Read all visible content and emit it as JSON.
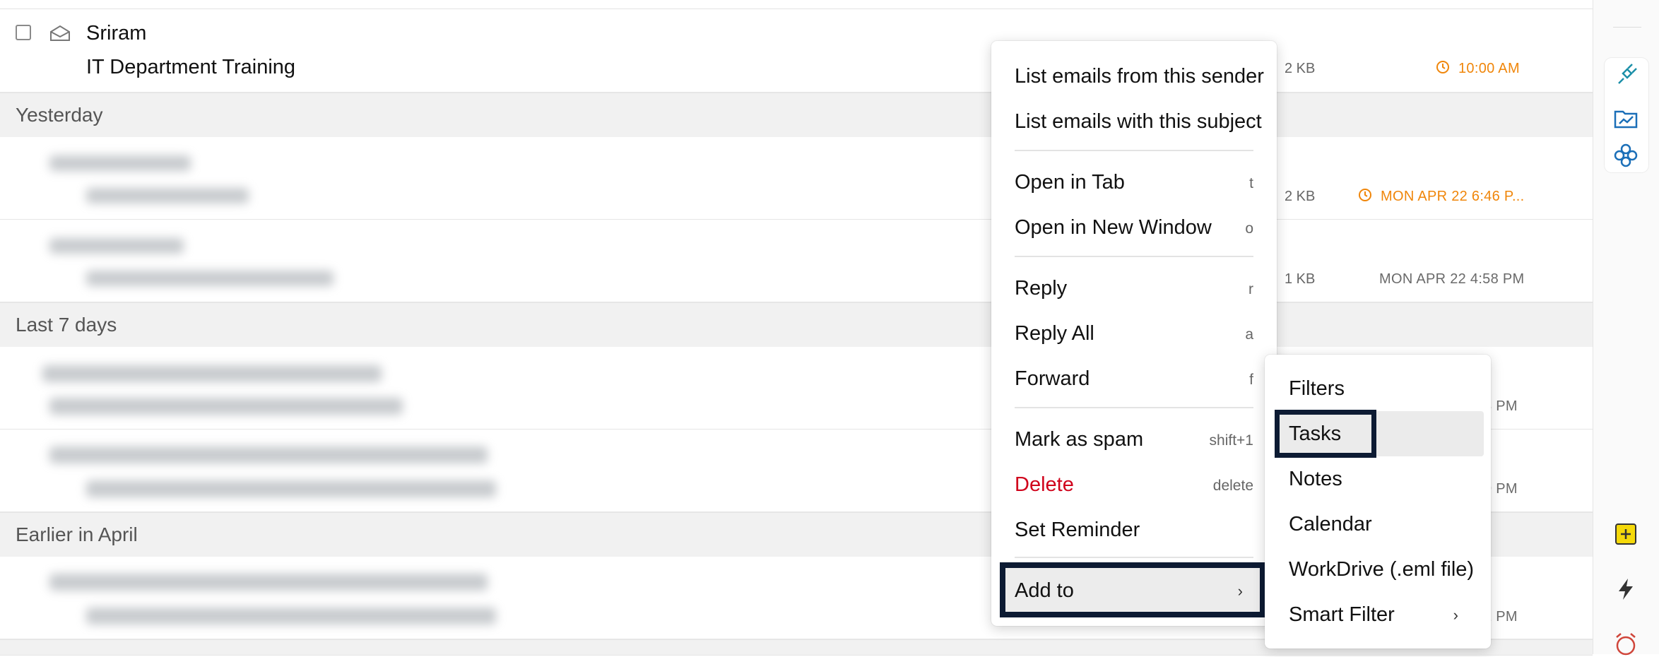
{
  "email_list": {
    "top_row": {
      "sender": "Sriram",
      "subject": "IT Department Training",
      "size": "2 KB",
      "time": "10:00 AM"
    },
    "groups": [
      {
        "label": "Yesterday",
        "rows": [
          {
            "size": "2 KB",
            "time": "MON APR 22 6:46 P..."
          },
          {
            "size": "1 KB",
            "time": "MON APR 22 4:58 PM"
          }
        ]
      },
      {
        "label": "Last 7 days",
        "rows": [
          {
            "time": "3 PM"
          },
          {
            "time": "9 PM"
          }
        ]
      },
      {
        "label": "Earlier in April",
        "rows": [
          {
            "time": "2 PM"
          }
        ]
      }
    ]
  },
  "context_menu": {
    "items": [
      {
        "label": "List emails from this sender",
        "key": ""
      },
      {
        "label": "List emails with this subject",
        "key": ""
      },
      {
        "label": "Open in Tab",
        "key": "t"
      },
      {
        "label": "Open in New Window",
        "key": "o"
      },
      {
        "label": "Reply",
        "key": "r"
      },
      {
        "label": "Reply All",
        "key": "a"
      },
      {
        "label": "Forward",
        "key": "f"
      },
      {
        "label": "Mark as spam",
        "key": "shift+1"
      },
      {
        "label": "Delete",
        "key": "delete"
      },
      {
        "label": "Set Reminder",
        "key": ""
      },
      {
        "label": "Add to",
        "key": ""
      }
    ],
    "add_to_chevron": "›"
  },
  "submenu": {
    "items": [
      {
        "label": "Filters"
      },
      {
        "label": "Tasks"
      },
      {
        "label": "Notes"
      },
      {
        "label": "Calendar"
      },
      {
        "label": "WorkDrive (.eml file)"
      },
      {
        "label": "Smart Filter"
      }
    ],
    "smart_filter_chevron": "›"
  },
  "colors": {
    "accent_orange": "#f0860a",
    "danger_red": "#d0021b",
    "highlight_border": "#0d1b33",
    "rail_teal": "#1b8fa8"
  },
  "icons": [
    "checkbox",
    "envelope-open-icon",
    "clock-icon",
    "plug-icon",
    "chart-folder-icon",
    "flower-icon",
    "add-note-icon",
    "lightning-icon",
    "alarm-clock-icon"
  ]
}
